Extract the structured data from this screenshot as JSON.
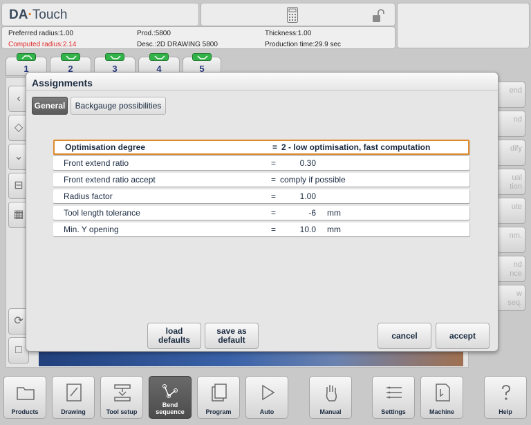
{
  "header": {
    "logo_left": "DA",
    "logo_dot": "·",
    "logo_right": "Touch",
    "preferred_radius": "Preferred radius:1.00",
    "computed_radius": "Computed radius:2.14",
    "prod": "Prod.:5800",
    "desc": "Desc.:2D DRAWING 5800",
    "thickness": "Thickness:1.00",
    "production_time": "Production time:29.9 sec"
  },
  "bend_tabs": [
    "1",
    "2",
    "3",
    "4",
    "5"
  ],
  "right_buttons": [
    "end",
    "nd",
    "dify",
    "ual\ntion",
    "ute",
    "nm.",
    "nd\nnce",
    "w\nseq."
  ],
  "dialog": {
    "title": "Assignments",
    "tabs": {
      "general": "General",
      "backgauge": "Backgauge possibilities"
    },
    "rows": [
      {
        "label": "Optimisation degree",
        "eq": "=",
        "value": "2 - low optimisation, fast computation"
      },
      {
        "label": "Front extend ratio",
        "eq": "=",
        "number": "0.30"
      },
      {
        "label": "Front extend ratio accept",
        "eq": "=",
        "value": "comply if possible"
      },
      {
        "label": "Radius factor",
        "eq": "=",
        "number": "1.00"
      },
      {
        "label": "Tool length tolerance",
        "eq": "=",
        "number": "-6",
        "unit": "mm"
      },
      {
        "label": "Min. Y opening",
        "eq": "=",
        "number": "10.0",
        "unit": "mm"
      }
    ],
    "buttons": {
      "load_defaults_1": "load",
      "load_defaults_2": "defaults",
      "save_default_1": "save as",
      "save_default_2": "default",
      "cancel": "cancel",
      "accept": "accept"
    }
  },
  "nav": {
    "products": "Products",
    "drawing": "Drawing",
    "tool_setup": "Tool setup",
    "bend_sequence_1": "Bend",
    "bend_sequence_2": "sequence",
    "program": "Program",
    "auto": "Auto",
    "manual": "Manual",
    "settings": "Settings",
    "machine": "Machine",
    "help": "Help"
  }
}
